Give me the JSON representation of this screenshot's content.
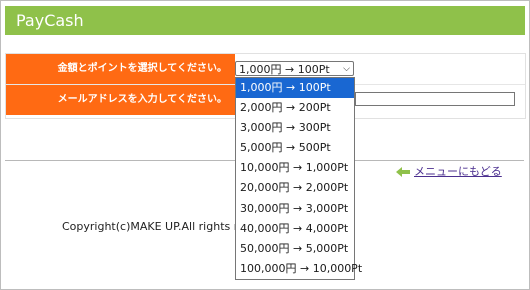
{
  "header": {
    "title": "PayCash"
  },
  "form": {
    "amount_label": "金額とポイントを選択してください。",
    "email_label": "メールアドレスを入力してください。",
    "amount_select": {
      "selected": "1,000円 → 100Pt",
      "options": [
        "1,000円 → 100Pt",
        "2,000円 → 200Pt",
        "3,000円 → 300Pt",
        "5,000円 → 500Pt",
        "10,000円 → 1,000Pt",
        "20,000円 → 2,000Pt",
        "30,000円 → 3,000Pt",
        "40,000円 → 4,000Pt",
        "50,000円 → 5,000Pt",
        "100,000円 → 10,000Pt"
      ]
    },
    "email_value": ""
  },
  "nav": {
    "back_to_menu": "メニューにもどる"
  },
  "footer": {
    "copyright": "Copyright(c)MAKE UP.All rights reserved."
  },
  "colors": {
    "header_bg": "#8fc14a",
    "label_bg": "#ff6a13",
    "selected_option": "#1967d2",
    "arrow_icon": "#8fc14a"
  }
}
